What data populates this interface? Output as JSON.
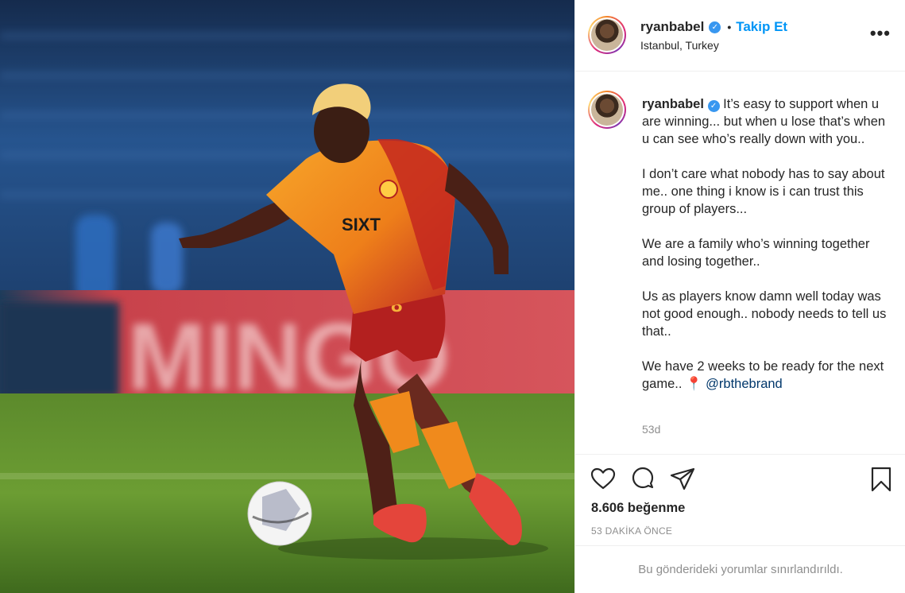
{
  "post": {
    "photo_alt": "photo",
    "sponsor_text": "MINGO"
  },
  "header": {
    "username": "ryanbabel",
    "verified_mark": "✓",
    "separator": "•",
    "follow_label": "Takip Et",
    "location": "Istanbul, Turkey",
    "more_label": "•••"
  },
  "caption": {
    "username": "ryanbabel",
    "verified_mark": "✓",
    "paragraph_1": " It’s easy to support when u are winning... but when u lose that’s when u can see who’s really down with you..",
    "paragraph_2": "I don’t care what nobody has to say about me.. one thing i know is i can trust this group of players...",
    "paragraph_3": "We are a family who’s winning together and losing together..",
    "paragraph_4": "Us as players know damn well today was not good enough.. nobody needs to tell us that..",
    "paragraph_5_text": "We have 2 weeks to be ready for the next game.. ",
    "paragraph_5_pin": "📍",
    "paragraph_5_mention": " @rbthebrand",
    "time_ago": "53d"
  },
  "actions": {
    "like_icon": "heart-icon",
    "comment_icon": "comment-icon",
    "share_icon": "paper-plane-icon",
    "save_icon": "bookmark-icon",
    "likes_text": "8.606 beğenme",
    "post_time": "53 DAKİKA ÖNCE"
  },
  "footer": {
    "comments_disabled": "Bu gönderideki yorumlar sınırlandırıldı."
  },
  "colors": {
    "link_blue": "#0095f6",
    "mention_blue": "#00376b",
    "muted_gray": "#8e8e8e",
    "text": "#262626",
    "jersey_orange": "#f08a1c",
    "jersey_red": "#b3201f"
  }
}
